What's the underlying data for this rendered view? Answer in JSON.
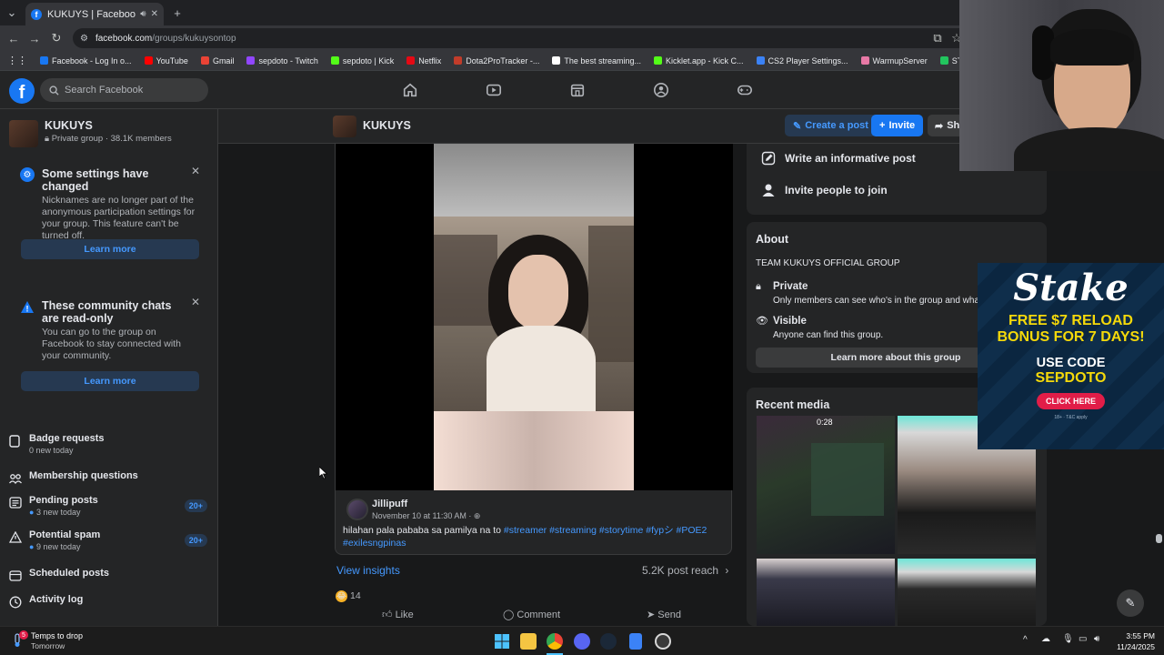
{
  "browser": {
    "tab_title": "KUKUYS | Facebook",
    "url_domain": "facebook.com",
    "url_path": "/groups/kukuysontop",
    "bookmarks": [
      {
        "label": "Facebook - Log In o...",
        "color": "#1877f2"
      },
      {
        "label": "YouTube",
        "color": "#ff0000"
      },
      {
        "label": "Gmail",
        "color": "#ea4335"
      },
      {
        "label": "sepdoto - Twitch",
        "color": "#9146ff"
      },
      {
        "label": "sepdoto | Kick",
        "color": "#53fc18"
      },
      {
        "label": "Netflix",
        "color": "#e50914"
      },
      {
        "label": "Dota2ProTracker -...",
        "color": "#c23c2a"
      },
      {
        "label": "The best streaming...",
        "color": "#ffffff"
      },
      {
        "label": "Kicklet.app - Kick C...",
        "color": "#53fc18"
      },
      {
        "label": "CS2 Player Settings...",
        "color": "#3b82f6"
      },
      {
        "label": "WarmupServer",
        "color": "#e879a6"
      },
      {
        "label": "STAKE",
        "color": "#22c55e"
      }
    ]
  },
  "facebook": {
    "search_placeholder": "Search Facebook",
    "brand_color": "#1877f2"
  },
  "sidebar": {
    "group_name": "KUKUYS",
    "group_meta": "Private group · 38.1K members",
    "notices": [
      {
        "title": "Some settings have changed",
        "body": "Nicknames are no longer part of the anonymous participation settings for your group. This feature can't be turned off.",
        "button": "Learn more"
      },
      {
        "title": "These community chats are read-only",
        "body": "You can go to the group on Facebook to stay connected with your community.",
        "button": "Learn more"
      }
    ],
    "admin_items": [
      {
        "label": "Badge requests",
        "sub": "0 new today",
        "badge": ""
      },
      {
        "label": "Membership questions",
        "sub": "",
        "badge": ""
      },
      {
        "label": "Pending posts",
        "sub": "3 new today",
        "badge": "20+"
      },
      {
        "label": "Potential spam",
        "sub": "9 new today",
        "badge": "20+"
      },
      {
        "label": "Scheduled posts",
        "sub": "",
        "badge": ""
      },
      {
        "label": "Activity log",
        "sub": "",
        "badge": ""
      }
    ]
  },
  "groupbar": {
    "name": "KUKUYS",
    "create_post": "Create a post",
    "invite": "Invite",
    "share": "Sha"
  },
  "post": {
    "author": "Jillipuff",
    "date": "November 10 at 11:30 AM · ",
    "caption_text": "hilahan pala pababa sa pamilya na to ",
    "hashtags_line1": "#streamer #streaming #storytime #fypシ #POE2",
    "hashtags_line2": "#exilesngpinas",
    "view_insights": "View insights",
    "reach": "5.2K post reach",
    "reaction_count": "14",
    "like": "Like",
    "comment": "Comment",
    "send": "Send"
  },
  "right": {
    "write_post": "Write an informative post",
    "invite_people": "Invite people to join",
    "about_title": "About",
    "about_desc": "TEAM KUKUYS OFFICIAL GROUP",
    "private_title": "Private",
    "private_desc": "Only members can see who's in the group and wha",
    "visible_title": "Visible",
    "visible_desc": "Anyone can find this group.",
    "learn_more_group": "Learn more about this group",
    "recent_media": "Recent media",
    "media_duration": "0:28"
  },
  "ad": {
    "brand": "Stake",
    "line1": "FREE $7 RELOAD",
    "line2": "BONUS FOR 7 DAYS!",
    "line3": "USE CODE",
    "code": "SEPDOTO",
    "cta": "CLICK HERE",
    "fine": "18+ · T&C apply"
  },
  "taskbar": {
    "weather_title": "Temps to drop",
    "weather_sub": "Tomorrow",
    "notif_count": "5",
    "time": "3:55 PM",
    "date": "11/24/2025"
  }
}
